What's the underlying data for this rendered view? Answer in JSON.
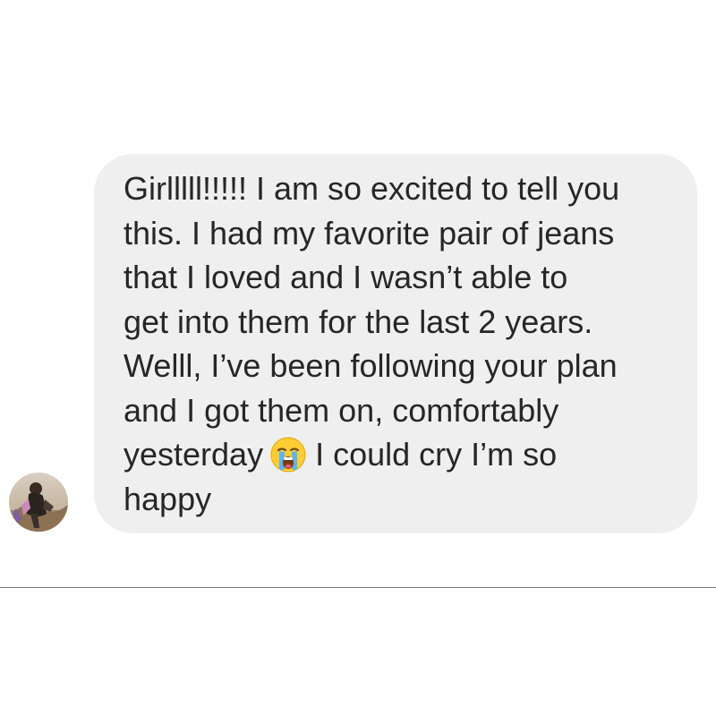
{
  "message": {
    "lines": [
      "Girlllll!!!!! I am so excited to tell you",
      "this. I had my favorite pair of jeans",
      "that I loved and I wasn’t able to",
      "get into them for the last 2 years.",
      "Welll, I’ve been following your plan",
      "and I got them on, comfortably"
    ],
    "line7_before_emoji": "yesterday",
    "line7_after_emoji": "I could cry I’m so",
    "line8": "happy"
  },
  "icons": {
    "emoji": "loudly-crying-face-icon",
    "avatar": "sender-avatar"
  },
  "colors": {
    "bubble": "#efefef",
    "text": "#262626",
    "divider": "#7a7a7a",
    "background": "#ffffff"
  }
}
